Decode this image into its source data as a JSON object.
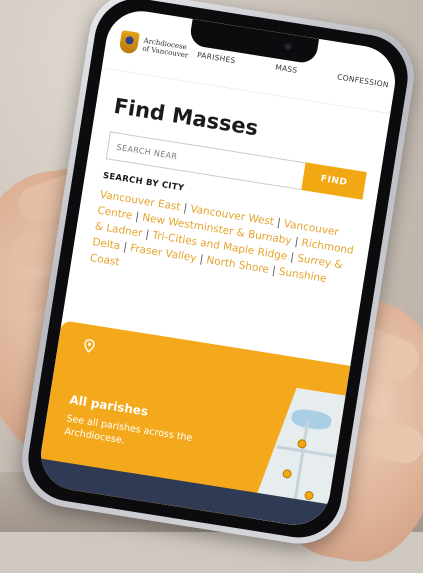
{
  "header": {
    "logo_line1": "Archdiocese",
    "logo_line2": "of Vancouver",
    "nav": [
      {
        "label": "PARISHES"
      },
      {
        "label": "MASS"
      },
      {
        "label": "CONFESSION"
      }
    ]
  },
  "main": {
    "title": "Find Masses",
    "search": {
      "placeholder": "SEARCH NEAR",
      "button_label": "FIND"
    },
    "by_city_label": "SEARCH BY CITY",
    "cities": [
      "Vancouver East",
      "Vancouver West",
      "Vancouver Centre",
      "New Westminster & Burnaby",
      "Richmond & Ladner",
      "Tri-Cities and Maple Ridge",
      "Surrey & Delta",
      "Fraser Valley",
      "North Shore",
      "Sunshine Coast"
    ]
  },
  "card": {
    "title": "All parishes",
    "description": "See all parishes across the Archdiocese.",
    "icon": "map-pin-icon"
  },
  "colors": {
    "accent": "#f2a813",
    "link": "#e5a42c",
    "text": "#1b1b1b"
  }
}
